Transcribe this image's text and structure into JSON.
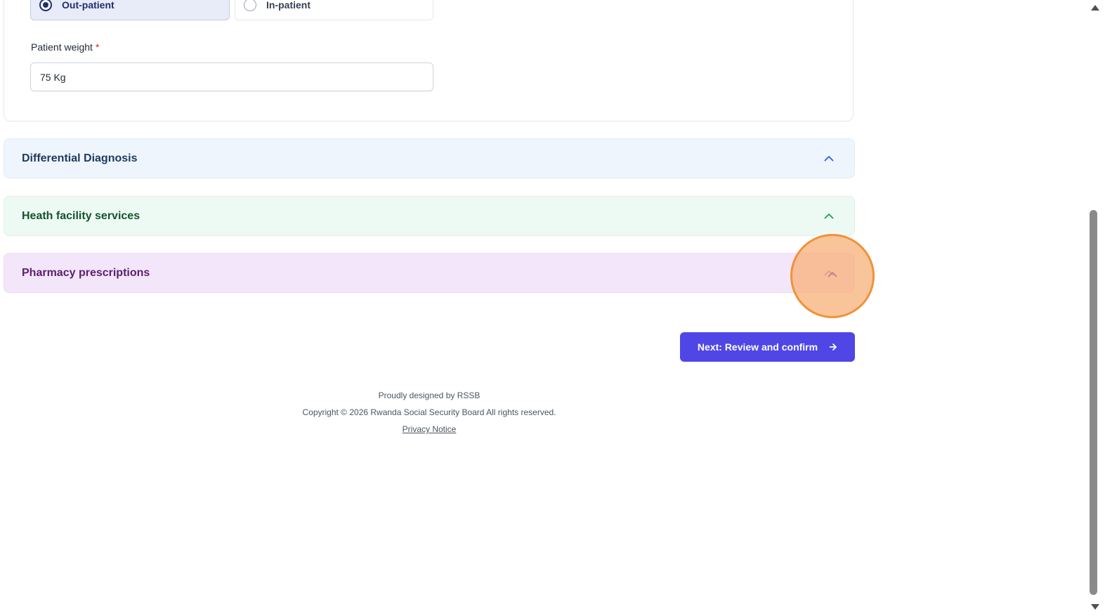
{
  "visit_type": {
    "options": [
      {
        "label": "Out-patient",
        "selected": true
      },
      {
        "label": "In-patient",
        "selected": false
      }
    ]
  },
  "patient_weight": {
    "label": "Patient weight",
    "required_mark": "*",
    "value": "75 Kg"
  },
  "accordions": {
    "differential_diagnosis": {
      "title": "Differential Diagnosis"
    },
    "health_facility_services": {
      "title": "Heath facility services"
    },
    "pharmacy_prescriptions": {
      "title": "Pharmacy prescriptions"
    }
  },
  "actions": {
    "next_label": "Next: Review and confirm"
  },
  "footer": {
    "designed_by": "Proudly designed by RSSB",
    "copyright": "Copyright © 2026 Rwanda Social Security Board All rights reserved.",
    "privacy_link": "Privacy Notice"
  },
  "colors": {
    "primary": "#4f46e5",
    "selected_radio": "#1e2f6b",
    "diagnosis_bg": "#eef5fd",
    "services_bg": "#edfaf3",
    "pharmacy_bg": "#f3e6fa",
    "highlight": "#f0923a"
  },
  "icons": {
    "accordion_toggle": "chevron-up-icon",
    "next_arrow": "arrow-right-icon"
  }
}
